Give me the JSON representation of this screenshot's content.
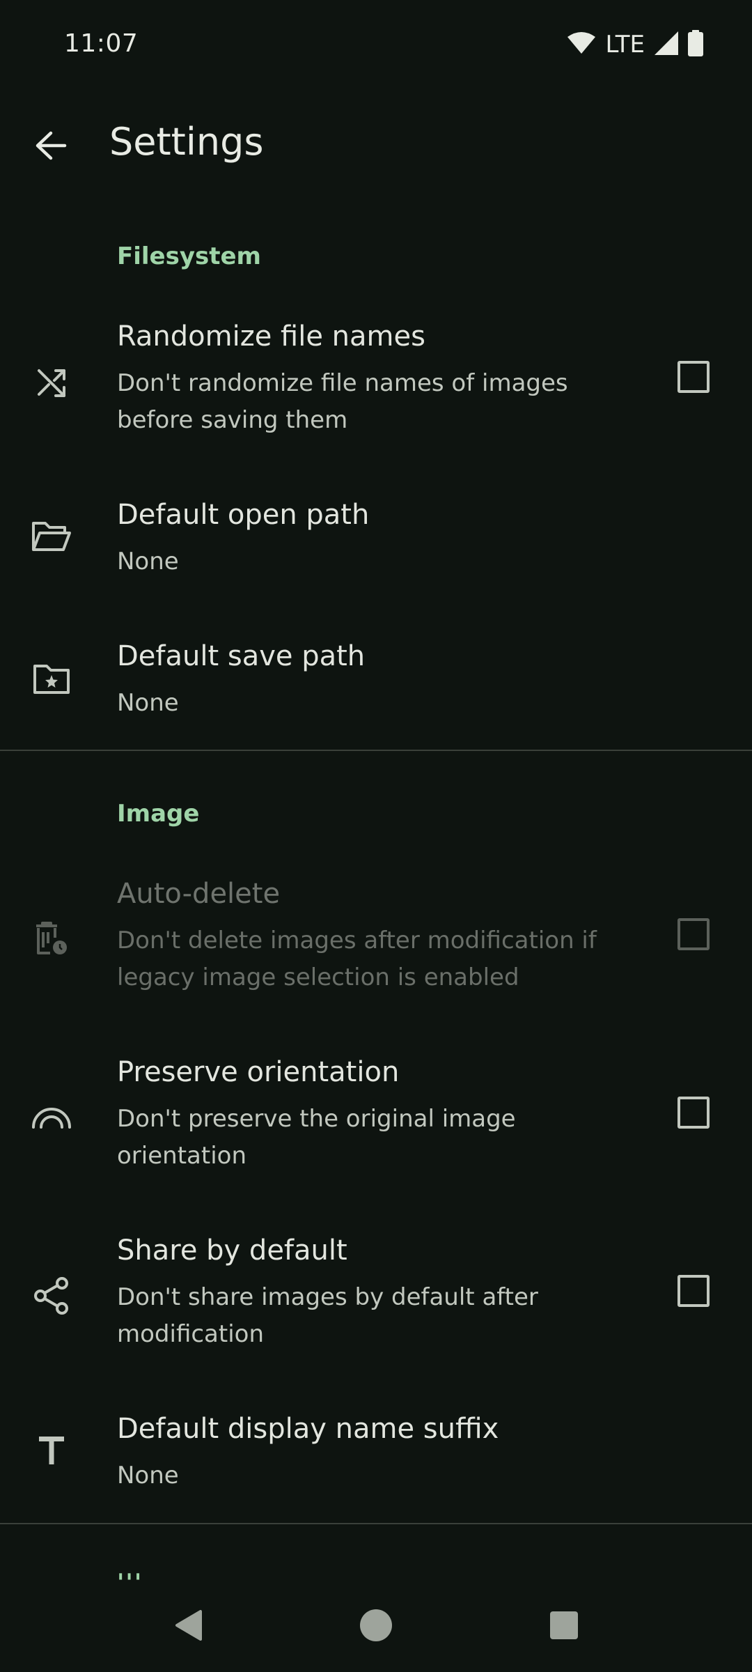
{
  "status_bar": {
    "time": "11:07",
    "network": "LTE"
  },
  "app_bar": {
    "title": "Settings"
  },
  "sections": {
    "filesystem": {
      "header": "Filesystem",
      "randomize": {
        "title": "Randomize file names",
        "summary": "Don't randomize file names of images before saving them",
        "checked": false,
        "icon": "shuffle-icon"
      },
      "open_path": {
        "title": "Default open path",
        "summary": "None",
        "icon": "folder-open-icon"
      },
      "save_path": {
        "title": "Default save path",
        "summary": "None",
        "icon": "folder-star-icon"
      }
    },
    "image": {
      "header": "Image",
      "auto_delete": {
        "title": "Auto-delete",
        "summary": "Don't delete images after modification if legacy image selection is enabled",
        "checked": false,
        "enabled": false,
        "icon": "delete-clock-icon"
      },
      "preserve_orientation": {
        "title": "Preserve orientation",
        "summary": "Don't preserve the original image orientation",
        "checked": false,
        "icon": "rotation-arc-icon"
      },
      "share_default": {
        "title": "Share by default",
        "summary": "Don't share images by default after modification",
        "checked": false,
        "icon": "share-icon"
      },
      "name_suffix": {
        "title": "Default display name suffix",
        "summary": "None",
        "icon": "text-icon"
      }
    }
  },
  "more_indicator": "'''",
  "colors": {
    "background": "#0e1410",
    "accent": "#9fd4a8",
    "text_primary": "#e3e6df",
    "text_secondary": "#c2c8bf",
    "divider": "#3a403a"
  }
}
